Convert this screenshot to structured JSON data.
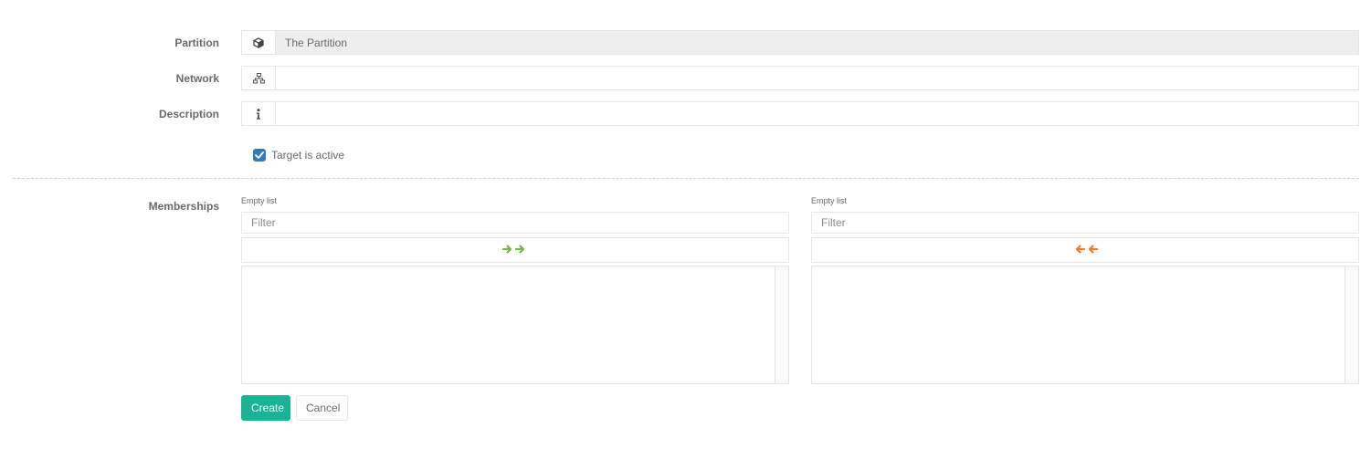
{
  "form": {
    "partition": {
      "label": "Partition",
      "value": "The Partition",
      "icon": "cube-icon"
    },
    "network": {
      "label": "Network",
      "value": "",
      "icon": "sitemap-icon"
    },
    "description": {
      "label": "Description",
      "value": "",
      "icon": "info-icon"
    },
    "active": {
      "label": "Target is active",
      "checked": true
    },
    "memberships": {
      "label": "Memberships",
      "available": {
        "info": "Empty list",
        "filter_placeholder": "Filter",
        "move_icon": "move-all-right-icon",
        "arrow_color": "#7ab44a"
      },
      "selected": {
        "info": "Empty list",
        "filter_placeholder": "Filter",
        "move_icon": "move-all-left-icon",
        "arrow_color": "#ed7d31"
      }
    }
  },
  "actions": {
    "create_label": "Create",
    "cancel_label": "Cancel"
  },
  "colors": {
    "primary": "#1ab394",
    "checkbox": "#337ab7"
  }
}
